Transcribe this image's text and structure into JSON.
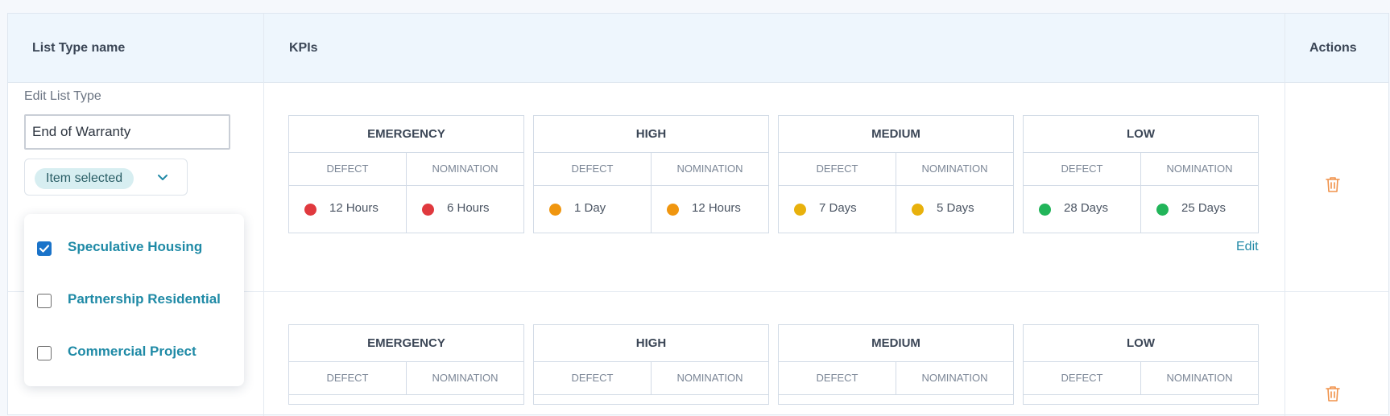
{
  "headers": {
    "name": "List Type name",
    "kpis": "KPIs",
    "actions": "Actions"
  },
  "edit": {
    "label": "Edit List Type",
    "value": "End of Warranty",
    "select_chip": "Item selected",
    "options": [
      {
        "label": "Speculative Housing",
        "checked": true
      },
      {
        "label": "Partnership Residential",
        "checked": false
      },
      {
        "label": "Commercial Project",
        "checked": false
      }
    ]
  },
  "kpi_rows": [
    {
      "groups": [
        {
          "title": "EMERGENCY",
          "sub": [
            "DEFECT",
            "NOMINATION"
          ],
          "values": [
            "12 Hours",
            "6 Hours"
          ],
          "color": "#e0393e"
        },
        {
          "title": "HIGH",
          "sub": [
            "DEFECT",
            "NOMINATION"
          ],
          "values": [
            "1 Day",
            "12 Hours"
          ],
          "color": "#f0960f"
        },
        {
          "title": "MEDIUM",
          "sub": [
            "DEFECT",
            "NOMINATION"
          ],
          "values": [
            "7 Days",
            "5 Days"
          ],
          "color": "#e8b10c"
        },
        {
          "title": "LOW",
          "sub": [
            "DEFECT",
            "NOMINATION"
          ],
          "values": [
            "28 Days",
            "25 Days"
          ],
          "color": "#22b55a"
        }
      ],
      "edit_link": "Edit"
    },
    {
      "groups": [
        {
          "title": "EMERGENCY",
          "sub": [
            "DEFECT",
            "NOMINATION"
          ]
        },
        {
          "title": "HIGH",
          "sub": [
            "DEFECT",
            "NOMINATION"
          ]
        },
        {
          "title": "MEDIUM",
          "sub": [
            "DEFECT",
            "NOMINATION"
          ]
        },
        {
          "title": "LOW",
          "sub": [
            "DEFECT",
            "NOMINATION"
          ]
        }
      ]
    }
  ],
  "colors": {
    "accent": "#2089a6",
    "trash": "#f0924a",
    "checkbox": "#1a73c9"
  },
  "icons": {
    "chevron": "chevron-down-icon",
    "delete": "trash-icon",
    "check": "check-icon"
  }
}
